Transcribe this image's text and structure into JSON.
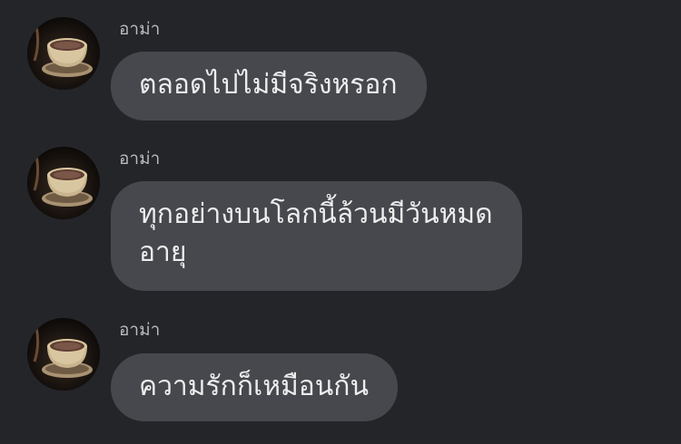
{
  "messages": [
    {
      "sender": "อาม่า",
      "avatar_icon": "tea-cup-avatar-icon",
      "lines": [
        "ตลอดไปไม่มีจริงหรอก"
      ]
    },
    {
      "sender": "อาม่า",
      "avatar_icon": "tea-cup-avatar-icon",
      "lines": [
        "ทุกอย่างบนโลกนี้ล้วนมีวันหมด",
        "อายุ"
      ]
    },
    {
      "sender": "อาม่า",
      "avatar_icon": "tea-cup-avatar-icon",
      "lines": [
        "ความรักก็เหมือนกัน"
      ]
    }
  ],
  "colors": {
    "background": "#242529",
    "bubble": "#47484d",
    "bubble_text": "#eceded",
    "sender_text": "#b8babd"
  }
}
